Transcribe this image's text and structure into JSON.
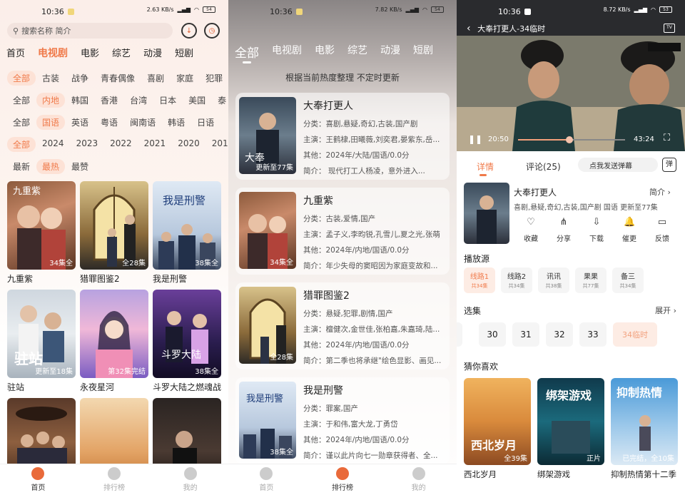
{
  "status": {
    "time": "10:36",
    "net_speed_1": "2.63 KB/s",
    "net_speed_2": "7.82 KB/s",
    "net_speed_3": "8.72 KB/s",
    "battery_1": "54",
    "battery_3": "53"
  },
  "home": {
    "search_placeholder": "搜索名称 简介",
    "tabs": [
      "首页",
      "电视剧",
      "电影",
      "综艺",
      "动漫",
      "短剧"
    ],
    "filter_rows": [
      [
        "全部",
        "古装",
        "战争",
        "青春偶像",
        "喜剧",
        "家庭",
        "犯罪"
      ],
      [
        "全部",
        "内地",
        "韩国",
        "香港",
        "台湾",
        "日本",
        "美国",
        "泰"
      ],
      [
        "全部",
        "国语",
        "英语",
        "粤语",
        "闽南语",
        "韩语",
        "日语"
      ],
      [
        "全部",
        "2024",
        "2023",
        "2022",
        "2021",
        "2020",
        "2019"
      ],
      [
        "最新",
        "最热",
        "最赞"
      ]
    ],
    "cards": [
      {
        "name": "九重紫",
        "ep": "34集全"
      },
      {
        "name": "猎罪图鉴2",
        "ep": "全28集"
      },
      {
        "name": "我是刑警",
        "ep": "38集全"
      },
      {
        "name": "驻站",
        "ep": "更新至18集"
      },
      {
        "name": "永夜星河",
        "ep": "第32集完结"
      },
      {
        "name": "斗罗大陆之燃魂战",
        "ep": "38集全"
      },
      {
        "name": "",
        "ep": ""
      },
      {
        "name": "",
        "ep": ""
      },
      {
        "name": "",
        "ep": ""
      }
    ],
    "poster_texts": {
      "jiuzhongzi": "九重紫",
      "woshixingjing": "我是刑警",
      "zhuzhan": "驻站",
      "douluo": "斗罗大陆",
      "dafeng": "大奉"
    }
  },
  "bottom_nav": [
    "首页",
    "排行榜",
    "我的"
  ],
  "ranking": {
    "tabs": [
      "全部",
      "电视剧",
      "电影",
      "综艺",
      "动漫",
      "短剧"
    ],
    "note": "根据当前热度整理 不定时更新",
    "items": [
      {
        "title": "大奉打更人",
        "cat": "分类：喜剧,悬疑,奇幻,古装,国产剧",
        "cast": "主演：王鹤棣,田曦薇,刘奕君,晏紫东,岳...",
        "other": "其他：2024年/大陆/国语/0.0分",
        "intro": "简介：    现代打工人杨凌，意外进入...",
        "ep": "更新至77集"
      },
      {
        "title": "九重紫",
        "cat": "分类：古装,爱情,国产",
        "cast": "主演：孟子义,李昀锐,孔雪儿,夏之光,张萌",
        "other": "其他：2024年/内地/国语/0.0分",
        "intro": "简介：年少失母的窦昭因为家庭变故和...",
        "ep": "34集全"
      },
      {
        "title": "猎罪图鉴2",
        "cat": "分类：悬疑,犯罪,剧情,国产",
        "cast": "主演：檀健次,金世佳,张柏嘉,朱嘉琦,陆...",
        "other": "其他：2024年/内地/国语/0.0分",
        "intro": "简介：第二季也将承继\"绘色显影、画见...",
        "ep": "全28集"
      },
      {
        "title": "我是刑警",
        "cat": "分类：罪案,国产",
        "cast": "主演：于和伟,富大龙,丁勇岱",
        "other": "其他：2024年/内地/国语/0.0分",
        "intro": "简介：谨以此片向七一勋章获得者、全...",
        "ep": "38集全"
      }
    ]
  },
  "player": {
    "title": "大奉打更人-34临时",
    "current": "20:50",
    "duration": "43:24",
    "progress": 0.48,
    "tabs": {
      "detail": "详情",
      "comments": "评论(25)"
    },
    "danmu_placeholder": "点我发送弹幕",
    "danmu_icon": "弹",
    "show": {
      "name": "大奉打更人",
      "intro_label": "简介",
      "meta": "喜剧,悬疑,奇幻,古装,国产剧 国语 更新至77集"
    },
    "actions": [
      {
        "label": "收藏",
        "icon": "heart-icon",
        "glyph": "♡"
      },
      {
        "label": "分享",
        "icon": "share-icon",
        "glyph": "⋔"
      },
      {
        "label": "下载",
        "icon": "download-icon",
        "glyph": "⇩"
      },
      {
        "label": "催更",
        "icon": "bell-icon",
        "glyph": "🔔"
      },
      {
        "label": "反馈",
        "icon": "feedback-icon",
        "glyph": "▭"
      }
    ],
    "source_heading": "播放源",
    "sources": [
      {
        "name": "线路1",
        "count": "共34集"
      },
      {
        "name": "线路2",
        "count": "共34集"
      },
      {
        "name": "讯讯",
        "count": "共38集"
      },
      {
        "name": "果果",
        "count": "共77集"
      },
      {
        "name": "备三",
        "count": "共34集"
      }
    ],
    "episodes_heading": "选集",
    "expand": "展开",
    "episodes": [
      "30",
      "31",
      "32",
      "33",
      "34临时"
    ],
    "rec_heading": "猜你喜欢",
    "recs": [
      {
        "name": "西北岁月",
        "ep": "全39集",
        "ptext": "西北岁月"
      },
      {
        "name": "绑架游戏",
        "ep": "正片",
        "ptext": "绑架游戏"
      },
      {
        "name": "抑制热情第十二季",
        "ep": "已完结，全10集",
        "ptext": "抑制热情"
      }
    ]
  }
}
